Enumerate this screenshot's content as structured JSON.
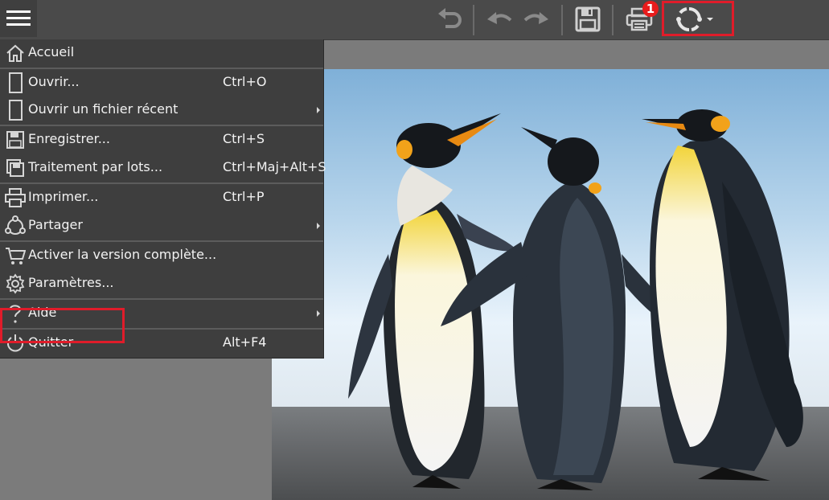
{
  "toolbar": {
    "notification_count": "1",
    "colors": {
      "background": "#4a4a4a",
      "badge": "#e81c1c",
      "highlight": "#e01c2a"
    }
  },
  "menu": {
    "items": [
      {
        "label": "Accueil",
        "shortcut": "",
        "icon": "home-icon",
        "submenu": false
      },
      {
        "label": "Ouvrir...",
        "shortcut": "Ctrl+O",
        "icon": "document-icon",
        "submenu": false
      },
      {
        "label": "Ouvrir un fichier récent",
        "shortcut": "",
        "icon": "document-icon",
        "submenu": true
      },
      {
        "label": "Enregistrer...",
        "shortcut": "Ctrl+S",
        "icon": "floppy-disk-icon",
        "submenu": false
      },
      {
        "label": "Traitement par lots...",
        "shortcut": "Ctrl+Maj+Alt+S",
        "icon": "batch-save-icon",
        "submenu": false
      },
      {
        "label": "Imprimer...",
        "shortcut": "Ctrl+P",
        "icon": "printer-icon",
        "submenu": false
      },
      {
        "label": "Partager",
        "shortcut": "",
        "icon": "share-icon",
        "submenu": true
      },
      {
        "label": "Activer la version complète...",
        "shortcut": "",
        "icon": "cart-icon",
        "submenu": false
      },
      {
        "label": "Paramètres...",
        "shortcut": "",
        "icon": "gear-icon",
        "submenu": false
      },
      {
        "label": "Aide",
        "shortcut": "",
        "icon": "question-icon",
        "submenu": true
      },
      {
        "label": "Quitter",
        "shortcut": "Alt+F4",
        "icon": "power-icon",
        "submenu": false
      }
    ]
  },
  "image": {
    "subject": "four-penguins-photo"
  }
}
